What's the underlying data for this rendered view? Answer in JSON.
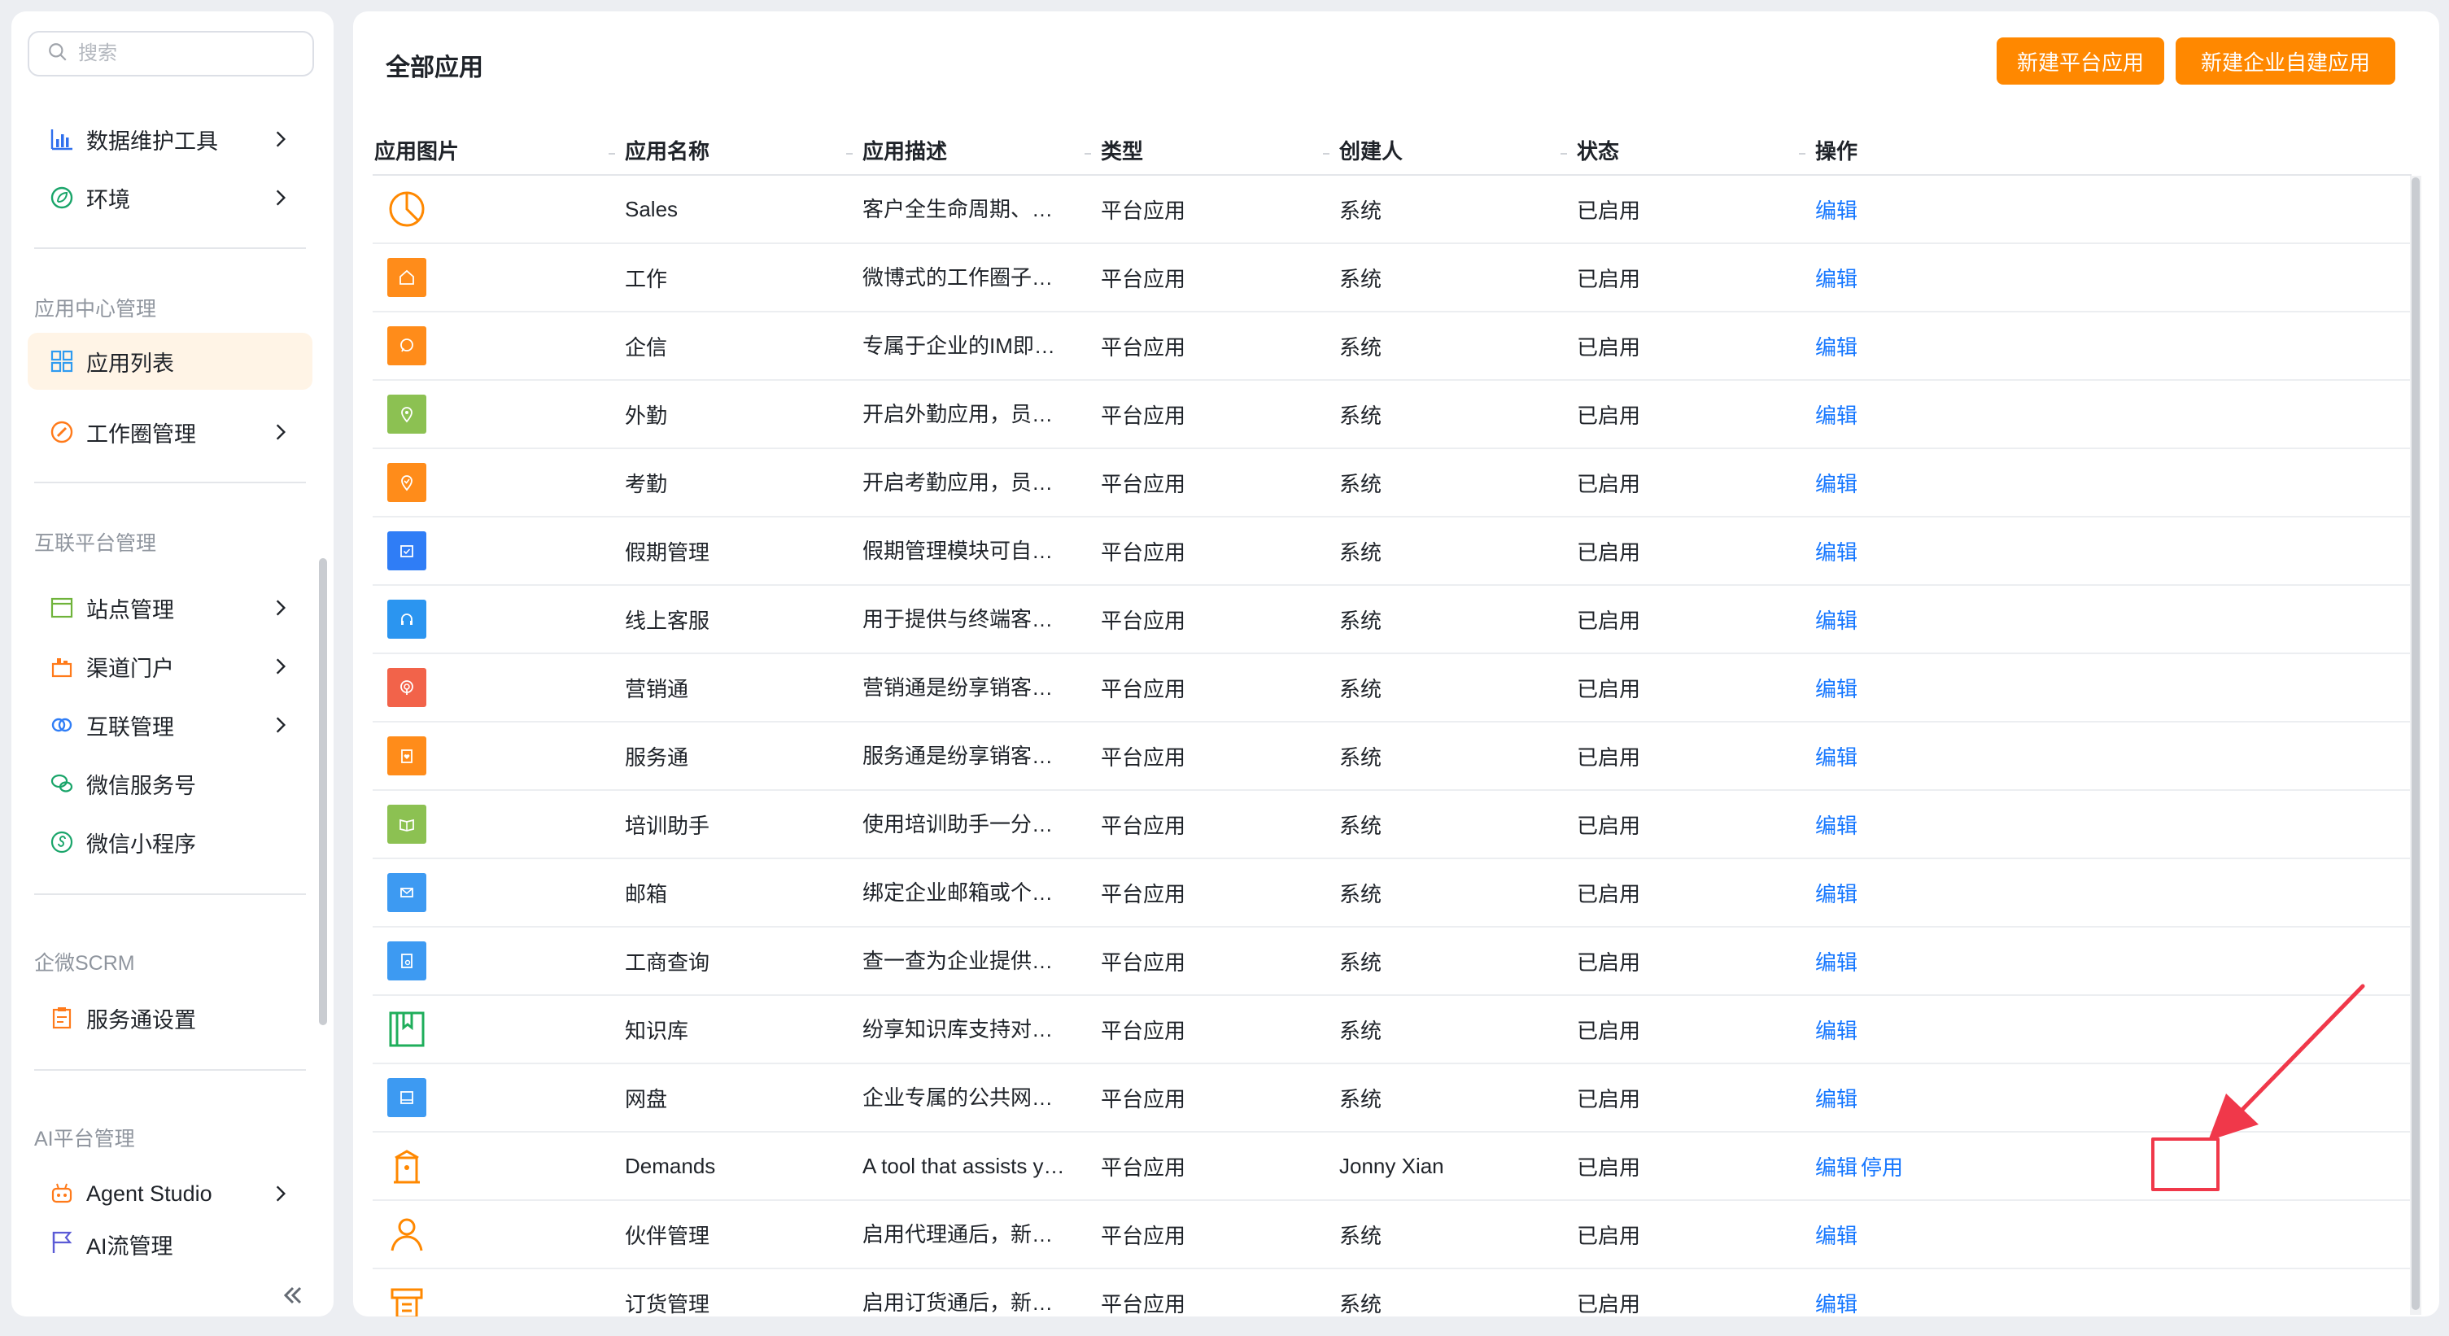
{
  "sidebar": {
    "search_placeholder": "搜索",
    "items_top": [
      {
        "label": "数据维护工具"
      },
      {
        "label": "环境"
      }
    ],
    "groups": [
      {
        "title": "应用中心管理",
        "items": [
          {
            "label": "应用列表"
          },
          {
            "label": "工作圈管理"
          }
        ]
      },
      {
        "title": "互联平台管理",
        "items": [
          {
            "label": "站点管理"
          },
          {
            "label": "渠道门户"
          },
          {
            "label": "互联管理"
          },
          {
            "label": "微信服务号"
          },
          {
            "label": "微信小程序"
          }
        ]
      },
      {
        "title": "企微SCRM",
        "items": [
          {
            "label": "服务通设置"
          }
        ]
      },
      {
        "title": "AI平台管理",
        "items": [
          {
            "label": "Agent Studio"
          },
          {
            "label": "AI流管理"
          }
        ]
      }
    ]
  },
  "main": {
    "title": "全部应用",
    "buttons": {
      "new_platform": "新建平台应用",
      "new_enterprise": "新建企业自建应用"
    },
    "columns": [
      "应用图片",
      "应用名称",
      "应用描述",
      "类型",
      "创建人",
      "状态",
      "操作"
    ],
    "rows": [
      {
        "icon": "pie-chart-icon",
        "color": "#ff8800",
        "name": "Sales",
        "desc": "客户全生命周期、…",
        "type": "平台应用",
        "creator": "系统",
        "status": "已启用",
        "actions": [
          "编辑"
        ]
      },
      {
        "icon": "home-icon",
        "color": "#ff8c1a",
        "name": "工作",
        "desc": "微博式的工作圈子…",
        "type": "平台应用",
        "creator": "系统",
        "status": "已启用",
        "actions": [
          "编辑"
        ]
      },
      {
        "icon": "chat-bubble-icon",
        "color": "#ff8c1a",
        "name": "企信",
        "desc": "专属于企业的IM即…",
        "type": "平台应用",
        "creator": "系统",
        "status": "已启用",
        "actions": [
          "编辑"
        ]
      },
      {
        "icon": "location-pin-icon",
        "color": "#8cc152",
        "name": "外勤",
        "desc": "开启外勤应用，员…",
        "type": "平台应用",
        "creator": "系统",
        "status": "已启用",
        "actions": [
          "编辑"
        ]
      },
      {
        "icon": "check-pin-icon",
        "color": "#ff8c1a",
        "name": "考勤",
        "desc": "开启考勤应用，员…",
        "type": "平台应用",
        "creator": "系统",
        "status": "已启用",
        "actions": [
          "编辑"
        ]
      },
      {
        "icon": "calendar-check-icon",
        "color": "#2f7df6",
        "name": "假期管理",
        "desc": "假期管理模块可自…",
        "type": "平台应用",
        "creator": "系统",
        "status": "已启用",
        "actions": [
          "编辑"
        ]
      },
      {
        "icon": "headset-icon",
        "color": "#2b95f0",
        "name": "线上客服",
        "desc": "用于提供与终端客…",
        "type": "平台应用",
        "creator": "系统",
        "status": "已启用",
        "actions": [
          "编辑"
        ]
      },
      {
        "icon": "broadcast-icon",
        "color": "#f2634a",
        "name": "营销通",
        "desc": "营销通是纷享销客…",
        "type": "平台应用",
        "creator": "系统",
        "status": "已启用",
        "actions": [
          "编辑"
        ]
      },
      {
        "icon": "clipboard-heart-icon",
        "color": "#ff8c1a",
        "name": "服务通",
        "desc": "服务通是纷享销客…",
        "type": "平台应用",
        "creator": "系统",
        "status": "已启用",
        "actions": [
          "编辑"
        ]
      },
      {
        "icon": "open-book-icon",
        "color": "#8cc152",
        "name": "培训助手",
        "desc": "使用培训助手一分…",
        "type": "平台应用",
        "creator": "系统",
        "status": "已启用",
        "actions": [
          "编辑"
        ]
      },
      {
        "icon": "envelope-icon",
        "color": "#3d9af2",
        "name": "邮箱",
        "desc": "绑定企业邮箱或个…",
        "type": "平台应用",
        "creator": "系统",
        "status": "已启用",
        "actions": [
          "编辑"
        ]
      },
      {
        "icon": "document-search-icon",
        "color": "#3d9af2",
        "name": "工商查询",
        "desc": "查一查为企业提供…",
        "type": "平台应用",
        "creator": "系统",
        "status": "已启用",
        "actions": [
          "编辑"
        ]
      },
      {
        "icon": "bookmark-book-icon",
        "color": "#1fae5b",
        "name": "知识库",
        "desc": "纷享知识库支持对…",
        "type": "平台应用",
        "creator": "系统",
        "status": "已启用",
        "actions": [
          "编辑"
        ]
      },
      {
        "icon": "hard-drive-icon",
        "color": "#3d9af2",
        "name": "网盘",
        "desc": "企业专属的公共网…",
        "type": "平台应用",
        "creator": "系统",
        "status": "已启用",
        "actions": [
          "编辑"
        ]
      },
      {
        "icon": "building-icon",
        "color": "#ff8800",
        "name": "Demands",
        "desc": "A tool that assists y…",
        "type": "平台应用",
        "creator": "Jonny Xian",
        "status": "已启用",
        "actions": [
          "编辑",
          "停用"
        ]
      },
      {
        "icon": "person-icon",
        "color": "#ff8800",
        "name": "伙伴管理",
        "desc": "启用代理通后，新…",
        "type": "平台应用",
        "creator": "系统",
        "status": "已启用",
        "actions": [
          "编辑"
        ]
      },
      {
        "icon": "register-icon",
        "color": "#ff8800",
        "name": "订货管理",
        "desc": "启用订货通后，新…",
        "type": "平台应用",
        "creator": "系统",
        "status": "已启用",
        "actions": [
          "编辑"
        ]
      }
    ]
  }
}
